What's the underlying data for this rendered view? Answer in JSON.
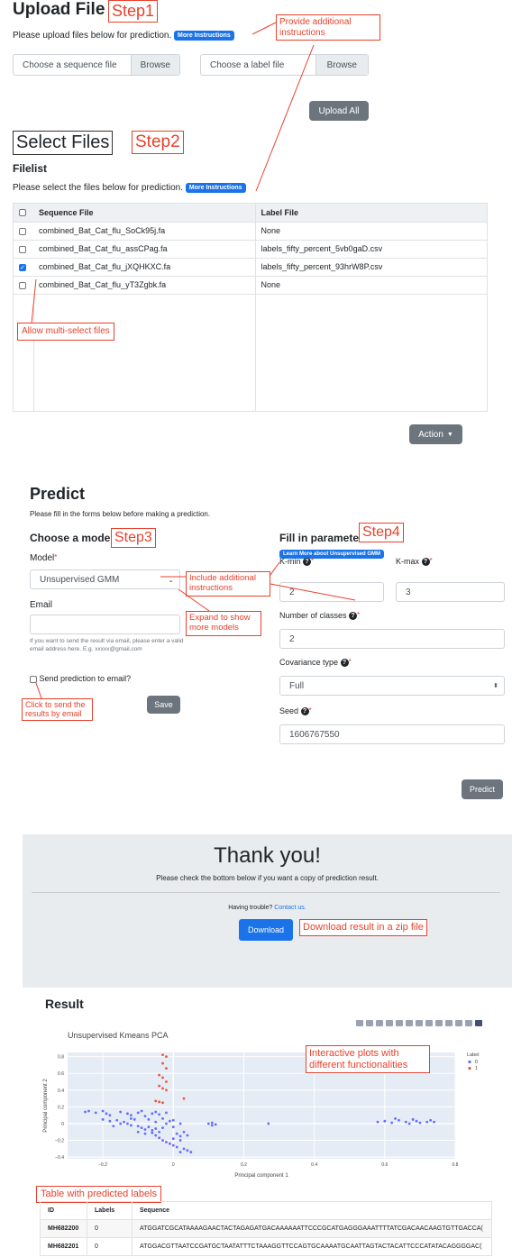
{
  "upload": {
    "title": "Upload File",
    "step": "Step1",
    "desc": "Please upload files below for prediction.",
    "more": "More Instructions",
    "seq_placeholder": "Choose a sequence file",
    "label_placeholder": "Choose a label file",
    "browse": "Browse",
    "upload_all": "Upload All",
    "ann_instructions": "Provide additional instructions"
  },
  "select": {
    "title": "Select Files",
    "step": "Step2",
    "filelist": "Filelist",
    "desc": "Please select the files below for prediction.",
    "more": "More Instructions",
    "col_seq": "Sequence File",
    "col_label": "Label File",
    "rows": [
      {
        "seq": "combined_Bat_Cat_flu_SoCk95j.fa",
        "label": "None",
        "checked": false
      },
      {
        "seq": "combined_Bat_Cat_flu_assCPag.fa",
        "label": "labels_fifty_percent_5vb0gaD.csv",
        "checked": false
      },
      {
        "seq": "combined_Bat_Cat_flu_jXQHKXC.fa",
        "label": "labels_fifty_percent_93hrW8P.csv",
        "checked": true
      },
      {
        "seq": "combined_Bat_Cat_flu_yT3Zgbk.fa",
        "label": "None",
        "checked": false
      }
    ],
    "ann_multiselect": "Allow multi-select files",
    "action": "Action"
  },
  "predict": {
    "title": "Predict",
    "desc": "Please fill in the forms below before making a prediction.",
    "choose_model": "Choose a model",
    "step3": "Step3",
    "model_label": "Model",
    "model_value": "Unsupervised GMM",
    "email_label": "Email",
    "email_help": "If you want to send the result via email, please enter a valid email address here. E.g. xxxxx@gmail.com",
    "send_email": "Send prediction to email?",
    "save": "Save",
    "ann_click_send": "Click to send the results by email",
    "ann_expand": "Expand to show more models",
    "ann_include": "Include additional instructions",
    "fill_params": "Fill in parameters",
    "step4": "Step4",
    "learn_more": "Learn More about Unsupervised GMM",
    "kmin_label": "K-min",
    "kmin_value": "2",
    "kmax_label": "K-max",
    "kmax_value": "3",
    "classes_label": "Number of classes",
    "classes_value": "2",
    "cov_label": "Covariance type",
    "cov_value": "Full",
    "seed_label": "Seed",
    "seed_value": "1606767550",
    "predict_btn": "Predict"
  },
  "thanks": {
    "title": "Thank you!",
    "desc": "Please check the bottom below if you want a copy of prediction result.",
    "trouble": "Having trouble?",
    "contact": "Contact us.",
    "download": "Download",
    "ann_download": "Download result in a zip file"
  },
  "result": {
    "title": "Result",
    "ann_plots": "Interactive plots with different functionalities",
    "ann_table": "Table with predicted labels",
    "table_headers": [
      "ID",
      "Labels",
      "Sequence"
    ],
    "rows": [
      {
        "id": "MH682200",
        "label": "0",
        "seq": "ATGGATCGCATAAAAGAACTACTAGAGATGACAAAAAATTCCCGCATGAGGGAAATTTTATCGACAACAAGTGTTGACCA("
      },
      {
        "id": "MH682201",
        "label": "0",
        "seq": "ATGGACGTTAATCCGATGCTAATATTTCTAAAGGTTCCAGTGCAAAATGCAATTAGTACTACATTCCCATATACAGGGGAC("
      }
    ]
  },
  "chart_data": {
    "type": "scatter",
    "title": "Unsupervised Kmeans PCA",
    "xlabel": "Principal component 1",
    "ylabel": "Principal component 2",
    "xlim": [
      -0.3,
      0.8
    ],
    "ylim": [
      -0.42,
      0.85
    ],
    "xticks": [
      -0.2,
      0,
      0.2,
      0.4,
      0.6,
      0.8
    ],
    "yticks": [
      -0.4,
      -0.2,
      0,
      0.2,
      0.4,
      0.6,
      0.8
    ],
    "xtick_labels": [
      "−0.2",
      "0",
      "0.2",
      "0.4",
      "0.6",
      "0.8"
    ],
    "ytick_labels": [
      "−0.4",
      "−0.2",
      "0",
      "0.2",
      "0.4",
      "0.6",
      "0.8"
    ],
    "legend_title": "Label",
    "legend_position": "right",
    "series": [
      {
        "name": "0",
        "color": "#636efa",
        "points": [
          [
            -0.25,
            0.14
          ],
          [
            -0.24,
            0.15
          ],
          [
            -0.22,
            0.13
          ],
          [
            -0.2,
            0.15
          ],
          [
            -0.19,
            0.12
          ],
          [
            -0.18,
            0.1
          ],
          [
            -0.15,
            0.14
          ],
          [
            -0.13,
            0.12
          ],
          [
            -0.12,
            0.1
          ],
          [
            -0.1,
            0.13
          ],
          [
            -0.09,
            0.15
          ],
          [
            -0.08,
            0.09
          ],
          [
            -0.06,
            0.12
          ],
          [
            -0.05,
            0.14
          ],
          [
            -0.04,
            0.11
          ],
          [
            -0.02,
            0.13
          ],
          [
            -0.2,
            0.05
          ],
          [
            -0.18,
            0.03
          ],
          [
            -0.16,
            0.04
          ],
          [
            -0.14,
            0.02
          ],
          [
            -0.13,
            0.0
          ],
          [
            -0.12,
            -0.02
          ],
          [
            -0.11,
            0.05
          ],
          [
            -0.1,
            -0.03
          ],
          [
            -0.09,
            -0.05
          ],
          [
            -0.08,
            -0.07
          ],
          [
            -0.07,
            -0.04
          ],
          [
            -0.06,
            -0.08
          ],
          [
            -0.05,
            -0.06
          ],
          [
            -0.04,
            -0.1
          ],
          [
            -0.03,
            -0.05
          ],
          [
            -0.02,
            0.0
          ],
          [
            -0.01,
            0.03
          ],
          [
            -0.1,
            -0.1
          ],
          [
            -0.08,
            -0.12
          ],
          [
            -0.06,
            -0.11
          ],
          [
            -0.05,
            -0.14
          ],
          [
            -0.04,
            -0.17
          ],
          [
            -0.03,
            -0.2
          ],
          [
            -0.02,
            -0.22
          ],
          [
            -0.01,
            -0.24
          ],
          [
            0.0,
            -0.26
          ],
          [
            0.01,
            -0.28
          ],
          [
            0.0,
            -0.18
          ],
          [
            0.02,
            -0.15
          ],
          [
            0.01,
            -0.12
          ],
          [
            0.03,
            -0.1
          ],
          [
            0.04,
            -0.14
          ],
          [
            0.02,
            -0.2
          ],
          [
            0.03,
            -0.3
          ],
          [
            0.04,
            -0.32
          ],
          [
            0.05,
            -0.34
          ],
          [
            0.02,
            -0.34
          ],
          [
            -0.07,
            0.05
          ],
          [
            -0.05,
            0.02
          ],
          [
            -0.03,
            0.06
          ],
          [
            0.0,
            0.04
          ],
          [
            0.02,
            0.0
          ],
          [
            0.0,
            -0.04
          ],
          [
            -0.12,
            0.06
          ],
          [
            -0.15,
            0.0
          ],
          [
            -0.17,
            -0.03
          ],
          [
            0.1,
            0.0
          ],
          [
            0.11,
            0.01
          ],
          [
            0.12,
            -0.01
          ],
          [
            0.11,
            -0.02
          ],
          [
            0.27,
            0.0
          ],
          [
            0.58,
            0.02
          ],
          [
            0.6,
            0.03
          ],
          [
            0.62,
            0.01
          ],
          [
            0.64,
            0.04
          ],
          [
            0.66,
            0.02
          ],
          [
            0.68,
            0.05
          ],
          [
            0.69,
            0.03
          ],
          [
            0.7,
            0.01
          ],
          [
            0.72,
            0.02
          ],
          [
            0.73,
            0.04
          ],
          [
            0.74,
            0.02
          ],
          [
            0.67,
            0.0
          ],
          [
            0.63,
            0.06
          ]
        ]
      },
      {
        "name": "1",
        "color": "#ef553b",
        "points": [
          [
            -0.03,
            0.82
          ],
          [
            -0.02,
            0.8
          ],
          [
            -0.03,
            0.72
          ],
          [
            -0.02,
            0.66
          ],
          [
            -0.04,
            0.58
          ],
          [
            -0.03,
            0.55
          ],
          [
            -0.02,
            0.5
          ],
          [
            -0.04,
            0.45
          ],
          [
            -0.03,
            0.42
          ],
          [
            -0.02,
            0.4
          ],
          [
            -0.05,
            0.27
          ],
          [
            -0.04,
            0.26
          ],
          [
            -0.03,
            0.25
          ],
          [
            0.03,
            0.3
          ]
        ]
      }
    ]
  }
}
